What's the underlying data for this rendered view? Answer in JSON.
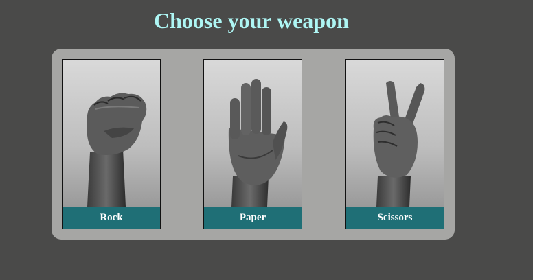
{
  "header": {
    "title": "Choose your weapon"
  },
  "colors": {
    "page_background": "#4a4a49",
    "panel_background": "#a6a6a4",
    "title_color": "#aef6f4",
    "label_background": "#1f6f76",
    "label_text": "#ffffff"
  },
  "weapons": [
    {
      "label": "Rock",
      "icon": "fist-hand-icon"
    },
    {
      "label": "Paper",
      "icon": "open-hand-icon"
    },
    {
      "label": "Scissors",
      "icon": "peace-sign-hand-icon"
    }
  ]
}
